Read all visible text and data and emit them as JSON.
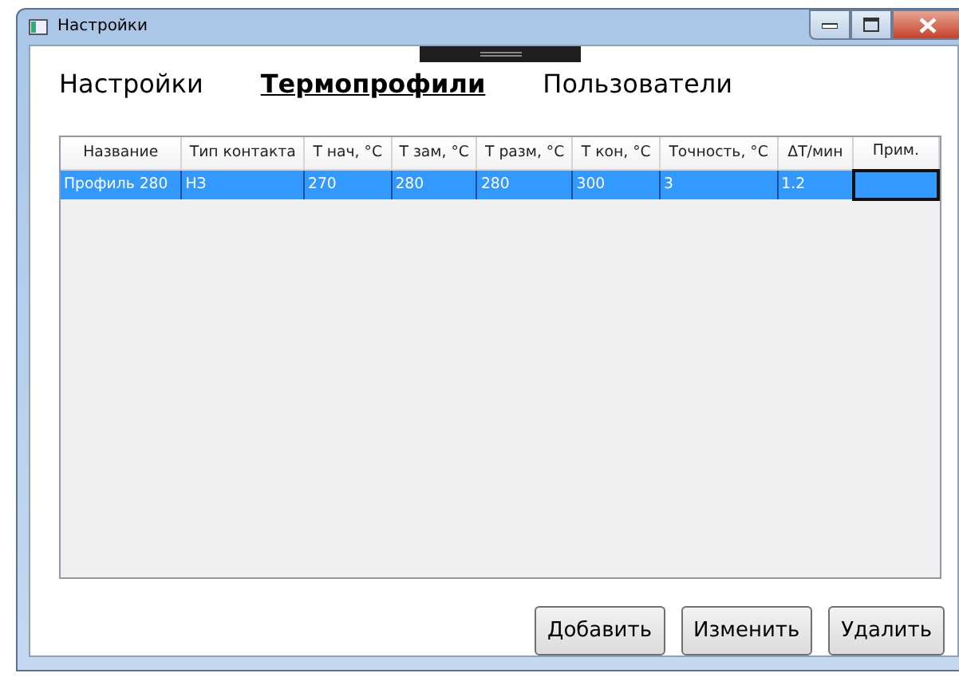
{
  "window": {
    "title": "Настройки"
  },
  "tabs": [
    {
      "label": "Настройки",
      "selected": false
    },
    {
      "label": "Термопрофили",
      "selected": true
    },
    {
      "label": "Пользователи",
      "selected": false
    }
  ],
  "table": {
    "columns": [
      "Название",
      "Тип контакта",
      "T нач, °C",
      "T зам, °C",
      "T разм, °C",
      "T кон, °C",
      "Точность, °C",
      "ΔT/мин",
      "Прим."
    ],
    "rows": [
      {
        "selected": true,
        "cells": [
          "Профиль 280",
          "НЗ",
          "270",
          "280",
          "280",
          "300",
          "3",
          "1.2",
          ""
        ]
      }
    ]
  },
  "buttons": [
    "Добавить",
    "Изменить",
    "Удалить"
  ]
}
